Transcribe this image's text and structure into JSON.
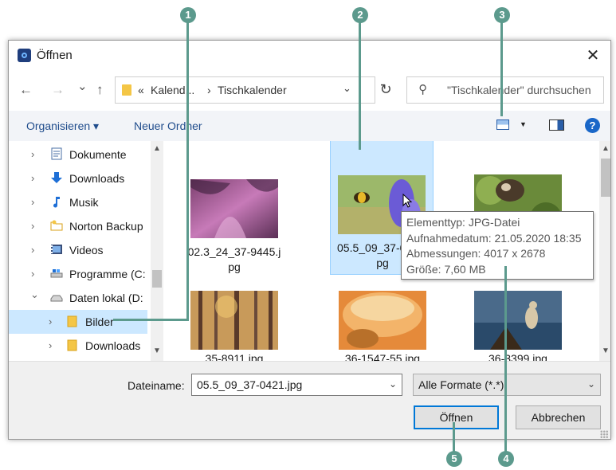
{
  "window": {
    "title": "Öffnen",
    "close_glyph": "✕"
  },
  "navigation": {
    "back_glyph": "←",
    "forward_glyph": "→",
    "recent_glyph": "⌄",
    "up_glyph": "↑",
    "breadcrumb_prefix": "«",
    "breadcrumb_1": "Kalend...",
    "breadcrumb_sep": "›",
    "breadcrumb_2": "Tischkalender",
    "address_chevron": "⌄",
    "refresh_glyph": "↻",
    "search_icon": "⚲",
    "search_placeholder": "\"Tischkalender\" durchsuchen"
  },
  "commandbar": {
    "organize": "Organisieren ▾",
    "new_folder": "Neuer Ordner",
    "view_dropdown": "▼",
    "help": "?"
  },
  "sidebar": {
    "items": [
      {
        "label": "Dokumente",
        "chevron": "›",
        "icon": "document-icon",
        "selected": false
      },
      {
        "label": "Downloads",
        "chevron": "›",
        "icon": "download-icon",
        "selected": false
      },
      {
        "label": "Musik",
        "chevron": "›",
        "icon": "music-icon",
        "selected": false
      },
      {
        "label": "Norton Backup",
        "chevron": "›",
        "icon": "backup-folder-icon",
        "selected": false
      },
      {
        "label": "Videos",
        "chevron": "›",
        "icon": "video-icon",
        "selected": false
      },
      {
        "label": "Programme (C:",
        "chevron": "›",
        "icon": "drive-icon",
        "selected": false
      },
      {
        "label": "Daten lokal (D:",
        "chevron": "⌄",
        "icon": "drive-icon",
        "selected": false
      },
      {
        "label": "Bilder",
        "chevron": "›",
        "icon": "folder-icon",
        "selected": true
      },
      {
        "label": "Downloads",
        "chevron": "›",
        "icon": "folder-icon",
        "selected": false
      }
    ],
    "scroll_up": "▲",
    "scroll_down": "▼"
  },
  "files": [
    {
      "name_line1": "02.3_24_37-9445.j",
      "name_line2": "pg",
      "selected": false
    },
    {
      "name_line1": "05.5_09_37-0",
      "name_line2": "pg",
      "selected": true
    },
    {
      "name_line1": "",
      "name_line2": "",
      "selected": false
    },
    {
      "name_line1": "35-8911.jpg",
      "name_line2": "",
      "selected": false
    },
    {
      "name_line1": "36-1547-55.jpg",
      "name_line2": "",
      "selected": false
    },
    {
      "name_line1": "36-3399.jpg",
      "name_line2": "",
      "selected": false
    }
  ],
  "main_scroll": {
    "up": "▲",
    "down": "▼"
  },
  "tooltip": {
    "type": "Elementtyp: JPG-Datei",
    "date": "Aufnahmedatum: 21.05.2020 18:35",
    "dimensions": "Abmessungen: 4017 x 2678",
    "size": "Größe: 7,60 MB"
  },
  "footer": {
    "filename_label": "Dateiname:",
    "filename_value": "05.5_09_37-0421.jpg",
    "filter_value": "Alle Formate (*.*)",
    "dropdown_glyph": "⌄",
    "open_button": "Öffnen",
    "cancel_button": "Abbrechen"
  },
  "callouts": [
    "1",
    "2",
    "3",
    "4",
    "5"
  ],
  "colors": {
    "accent": "#0078d7",
    "selection": "#cce8ff",
    "callout": "#5c9a8d",
    "link_text": "#1f4c8c"
  }
}
